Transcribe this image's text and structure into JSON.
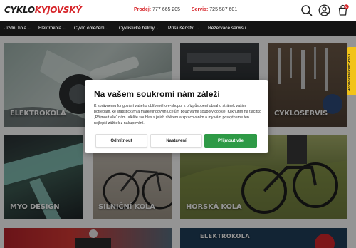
{
  "header": {
    "logo": {
      "part1": "CYKLO",
      "part2": "KYJOVSKÝ"
    },
    "sales_label": "Prodej:",
    "sales_phone": "777 665 205",
    "service_label": "Servis:",
    "service_phone": "725 587 601",
    "icons": [
      "search-icon",
      "user-icon",
      "cart-icon"
    ],
    "cart_count": "0"
  },
  "nav": {
    "items": [
      {
        "label": "Jízdní kola",
        "chevron": "⌄"
      },
      {
        "label": "Elektrokola",
        "chevron": "⌄"
      },
      {
        "label": "Cyklo oblečení",
        "chevron": "⌄"
      },
      {
        "label": "Cyklistické helmy",
        "chevron": "⌄"
      },
      {
        "label": "Příslušenství",
        "chevron": "⌄"
      },
      {
        "label": "Rezervace servisu",
        "chevron": ""
      }
    ]
  },
  "tiles": [
    {
      "label": "ELEKTROKOLA"
    },
    {
      "label": "CYKLOSERVIS"
    },
    {
      "label": "MYO DESIGN"
    },
    {
      "label": "SILNIČNÍ KOLA"
    },
    {
      "label": "HORSKÁ KOLA"
    },
    {
      "label": "ELEKTROKOLA"
    }
  ],
  "side_tab": {
    "label": "HODNOCENÍ OBCHODU"
  },
  "cookie_modal": {
    "title": "Na vašem soukromí nám záleží",
    "text": "K správnému fungování vašeho oblíbeného e-shopu, k přizpůsobení obsahu stránek vašim potřebám, ke statistickým a marketingovým účelům používáme soubory cookie. Kliknutím na tlačítko „Přijmout vše“ nám udělíte souhlas s jejich sběrem a zpracováním a my vám poskytneme ten nejlepší zážitek z nakupování.",
    "reject_label": "Odmítnout",
    "settings_label": "Nastavení",
    "accept_label": "Přijmout vše"
  },
  "colors": {
    "brand_red": "#d7262b",
    "nav_bg": "#141414",
    "accept_green": "#2e9a46",
    "side_tab_yellow": "#f2c318"
  }
}
